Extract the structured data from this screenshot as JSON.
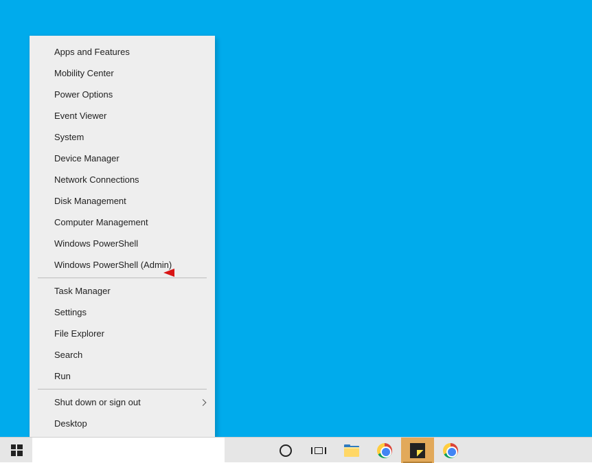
{
  "context_menu": {
    "groups": [
      [
        {
          "label": "Apps and Features"
        },
        {
          "label": "Mobility Center"
        },
        {
          "label": "Power Options"
        },
        {
          "label": "Event Viewer"
        },
        {
          "label": "System"
        },
        {
          "label": "Device Manager"
        },
        {
          "label": "Network Connections"
        },
        {
          "label": "Disk Management"
        },
        {
          "label": "Computer Management"
        },
        {
          "label": "Windows PowerShell"
        },
        {
          "label": "Windows PowerShell (Admin)"
        }
      ],
      [
        {
          "label": "Task Manager"
        },
        {
          "label": "Settings"
        },
        {
          "label": "File Explorer"
        },
        {
          "label": "Search"
        },
        {
          "label": "Run"
        }
      ],
      [
        {
          "label": "Shut down or sign out",
          "submenu": true
        },
        {
          "label": "Desktop"
        }
      ]
    ]
  },
  "annotation": {
    "target_label": "Windows PowerShell (Admin)",
    "color": "#d81515"
  },
  "taskbar": {
    "icons": [
      "cortana",
      "task-view",
      "file-explorer",
      "chrome",
      "sticky-notes",
      "chrome"
    ],
    "active_index": 4
  }
}
